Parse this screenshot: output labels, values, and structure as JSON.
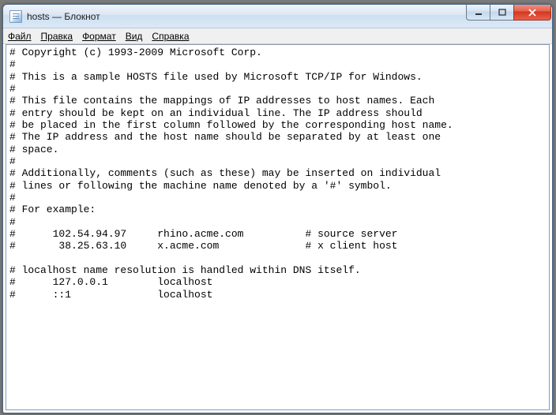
{
  "window": {
    "title": "hosts — Блокнот"
  },
  "menu": {
    "file": "Файл",
    "edit": "Правка",
    "format": "Формат",
    "view": "Вид",
    "help": "Справка"
  },
  "content": "# Copyright (c) 1993-2009 Microsoft Corp.\n#\n# This is a sample HOSTS file used by Microsoft TCP/IP for Windows.\n#\n# This file contains the mappings of IP addresses to host names. Each\n# entry should be kept on an individual line. The IP address should\n# be placed in the first column followed by the corresponding host name.\n# The IP address and the host name should be separated by at least one\n# space.\n#\n# Additionally, comments (such as these) may be inserted on individual\n# lines or following the machine name denoted by a '#' symbol.\n#\n# For example:\n#\n#      102.54.94.97     rhino.acme.com          # source server\n#       38.25.63.10     x.acme.com              # x client host\n\n# localhost name resolution is handled within DNS itself.\n#      127.0.0.1        localhost\n#      ::1              localhost"
}
